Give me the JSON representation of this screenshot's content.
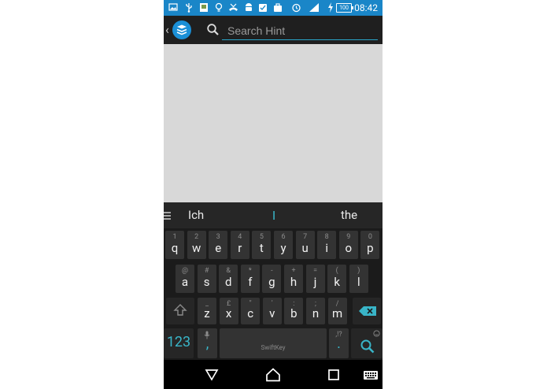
{
  "status_bar": {
    "time": "08:42",
    "battery": "100",
    "icons": [
      "image-icon",
      "usb-icon",
      "photo-icon",
      "bulb-icon",
      "missed-call-icon",
      "android-icon",
      "download-done-icon",
      "briefcase-icon",
      "alarm-icon",
      "signal-icon",
      "charging-icon"
    ],
    "color": "#1a86c8"
  },
  "action_bar": {
    "back_glyph": "‹",
    "search_placeholder": "Search Hint",
    "search_value": "",
    "accent": "#2aa3c7"
  },
  "suggestions": [
    "Ich",
    "I",
    "the"
  ],
  "keyboard": {
    "row1": [
      {
        "main": "q",
        "alt": "1"
      },
      {
        "main": "w",
        "alt": "2"
      },
      {
        "main": "e",
        "alt": "3"
      },
      {
        "main": "r",
        "alt": "4"
      },
      {
        "main": "t",
        "alt": "5"
      },
      {
        "main": "y",
        "alt": "6"
      },
      {
        "main": "u",
        "alt": "7"
      },
      {
        "main": "i",
        "alt": "8"
      },
      {
        "main": "o",
        "alt": "9"
      },
      {
        "main": "p",
        "alt": "0"
      }
    ],
    "row2": [
      {
        "main": "a",
        "alt": "@"
      },
      {
        "main": "s",
        "alt": "#"
      },
      {
        "main": "d",
        "alt": "&"
      },
      {
        "main": "f",
        "alt": "*"
      },
      {
        "main": "g",
        "alt": "-"
      },
      {
        "main": "h",
        "alt": "+"
      },
      {
        "main": "j",
        "alt": "="
      },
      {
        "main": "k",
        "alt": "("
      },
      {
        "main": "l",
        "alt": ")"
      }
    ],
    "row3": [
      {
        "main": "z",
        "alt": "_"
      },
      {
        "main": "x",
        "alt": "£"
      },
      {
        "main": "c",
        "alt": "\""
      },
      {
        "main": "v",
        "alt": "'"
      },
      {
        "main": "b",
        "alt": ":"
      },
      {
        "main": "n",
        "alt": ";"
      },
      {
        "main": "m",
        "alt": "/"
      }
    ],
    "numbers_label": "123",
    "comma": ",",
    "period": ".",
    "period_alt": ",!?",
    "space_brand": "SwiftKey",
    "accent": "#39b5c8"
  },
  "nav_bar": {
    "icons": [
      "back-icon",
      "home-icon",
      "recents-icon",
      "keyboard-icon"
    ]
  }
}
